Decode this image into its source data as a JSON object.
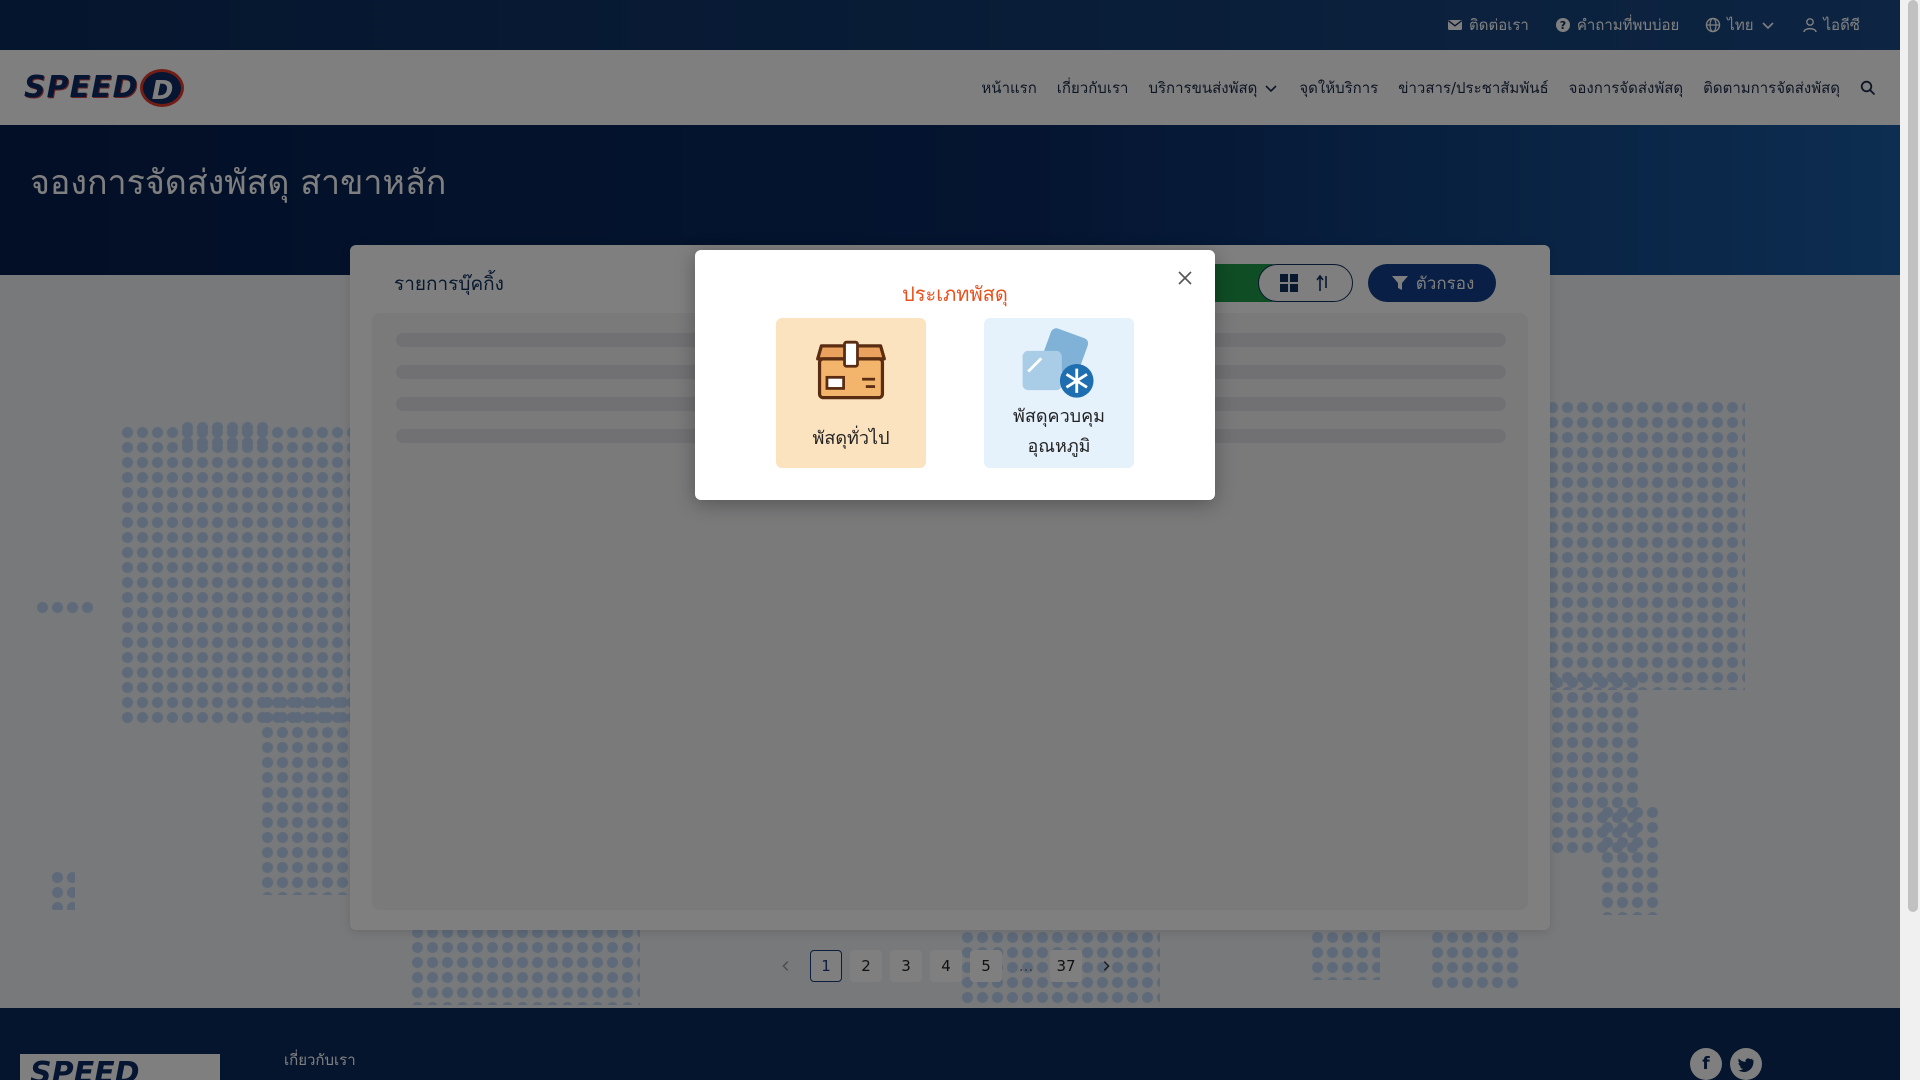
{
  "topbar": {
    "contact": "ติดต่อเรา",
    "faq": "คำถามที่พบบ่อย",
    "language": "ไทย",
    "user": "ไอดีซี"
  },
  "nav": {
    "logo": "SPEED",
    "logo_mark": "D",
    "items": [
      "หน้าแรก",
      "เกี่ยวกับเรา",
      "บริการขนส่งพัสดุ",
      "จุดให้บริการ",
      "ข่าวสาร/ประชาสัมพันธ์",
      "จองการจัดส่งพัสดุ",
      "ติดตามการจัดส่งพัสดุ"
    ]
  },
  "hero": {
    "title": "จองการจัดส่งพัสดุ สาขาหลัก"
  },
  "card": {
    "title": "รายการบุ๊คกิ้ง",
    "filter_label": "ตัวกรอง"
  },
  "pagination": {
    "pages": [
      "1",
      "2",
      "3",
      "4",
      "5",
      "...",
      "37"
    ],
    "current": "1"
  },
  "footer": {
    "about": "เกี่ยวกับเรา",
    "logo": "SPEED"
  },
  "modal": {
    "title": "ประเภทพัสดุ",
    "options": [
      {
        "label": "พัสดุทั่วไป",
        "icon": "parcel-box-icon"
      },
      {
        "label_line1": "พัสดุควบคุม",
        "label_line2": "อุณหภูมิ",
        "icon": "cold-parcel-icon"
      }
    ]
  },
  "colors": {
    "primary_dark": "#0b2a5c",
    "accent_orange": "#e8501e",
    "filter_blue": "#123f8a",
    "green": "#1f9a4a"
  }
}
